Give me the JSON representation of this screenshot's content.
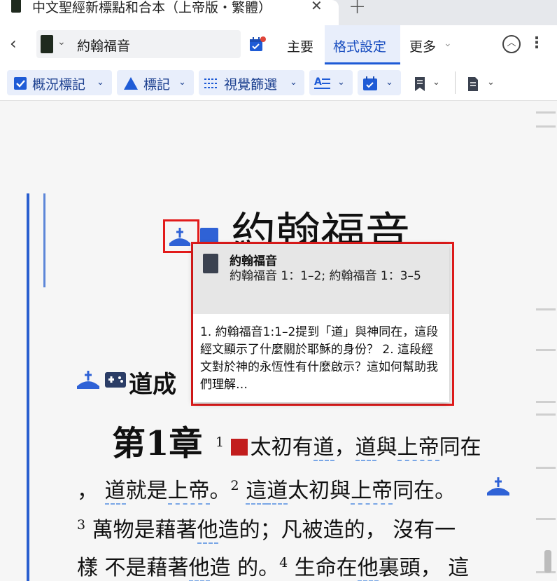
{
  "tab": {
    "title": "中文聖經新標點和合本（上帝版・繁體）",
    "close_glyph": "✕",
    "new_tab_glyph": "+"
  },
  "nav": {
    "back_glyph": "‹",
    "resource_dropdown_glyph": "⌄",
    "resource_title": "約翰福音",
    "tabs": [
      {
        "label": "主要"
      },
      {
        "label": "格式設定"
      },
      {
        "label": "更多"
      }
    ],
    "more_chevron_glyph": "⌄",
    "collapse_glyph": "︿",
    "kebab_glyph": "⋮"
  },
  "toolbar": {
    "overview_label": "概況標記",
    "mark_label": "標記",
    "visual_filter_label": "視覺篩選",
    "chevron_glyph": "⌄",
    "icons": [
      "checkbox-icon",
      "triangle-icon",
      "filter-icon",
      "text-format-icon",
      "calendar-icon",
      "bookmark-icon",
      "note-icon"
    ],
    "accent_color": "#1b3f8f",
    "button_bg": "#e8eefb"
  },
  "content": {
    "book_title": "約翰福音",
    "section_title": "道成",
    "chapter_heading": "第1章",
    "verses": {
      "v1_num": "1",
      "v1_text_a": "太初有",
      "v1_dao1": "道",
      "v1_comma": "，",
      "v1_dao2": "道",
      "v1_with": "與",
      "v1_god": "上帝",
      "v1_tail": "同在",
      "l2_comma": "，",
      "l2_dao": "道",
      "l2_is": "就是",
      "l2_god": "上帝",
      "l2_end": "。",
      "v2_num": "2",
      "v2_this": "這",
      "v2_dao": "道",
      "v2_mid": "太初與",
      "v2_god": "上帝",
      "v2_end": "同在。",
      "v3_num": "3",
      "v3_a": "萬物是藉著",
      "v3_he": "他",
      "v3_b": "造的；凡被造的，",
      "v3_c": "沒有一",
      "l4_a": "樣",
      "l4_b": "不是藉著",
      "l4_he": "他",
      "l4_c": "造",
      "l4_d": "的。",
      "v4_num": "4",
      "v4_a": "生命在",
      "v4_he": "他",
      "v4_b": "裏頭，",
      "v4_c": "這"
    }
  },
  "popup": {
    "title": "約翰福音",
    "refs": "約翰福音 1：1–2; 約翰福音 1：3–5",
    "body": "1. 約翰福音1:1–2提到「道」與神同在，這段經文顯示了什麼關於耶穌的身份？ 2. 這段經文對於神的永恆性有什麼啟示？這如何幫助我們理解…",
    "highlight_color": "#e21b1b"
  }
}
